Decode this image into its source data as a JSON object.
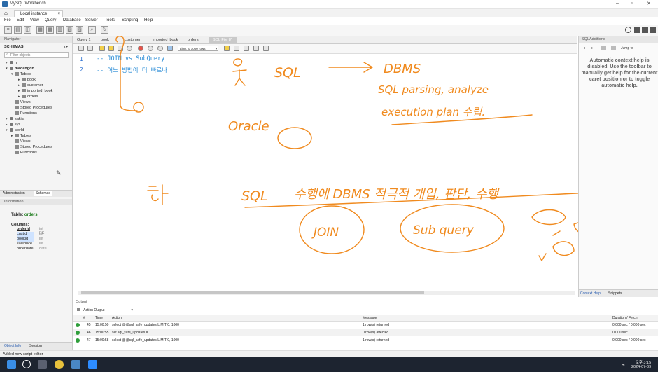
{
  "window": {
    "title": "MySQL Workbench",
    "instance_tab": "Local instance MySQL80"
  },
  "menu": [
    "File",
    "Edit",
    "View",
    "Query",
    "Database",
    "Server",
    "Tools",
    "Scripting",
    "Help"
  ],
  "navigator": {
    "header": "Navigator",
    "schemas_label": "SCHEMAS",
    "filter_placeholder": "Filter objects",
    "tree": {
      "hr": "hr",
      "madangdb": "madangdb",
      "tables": "Tables",
      "book": "book",
      "customer": "customer",
      "imported_book": "imported_book",
      "orders": "orders",
      "views": "Views",
      "procs": "Stored Procedures",
      "funcs": "Functions",
      "sakila": "sakila",
      "sys": "sys",
      "world": "world",
      "w_tables": "Tables",
      "w_views": "Views",
      "w_procs": "Stored Procedures",
      "w_funcs": "Functions"
    },
    "tabs": {
      "admin": "Administration",
      "schemas": "Schemas"
    }
  },
  "information": {
    "header": "Information",
    "table_label": "Table:",
    "table_name": "orders",
    "columns_label": "Columns:",
    "columns": [
      {
        "name": "orderid",
        "type": "int PK"
      },
      {
        "name": "custid",
        "type": "int"
      },
      {
        "name": "bookid",
        "type": "int"
      },
      {
        "name": "saleprice",
        "type": "int"
      },
      {
        "name": "orderdate",
        "type": "date"
      }
    ],
    "tabs": {
      "object": "Object Info",
      "session": "Session"
    }
  },
  "editor_tabs": [
    "Query 1",
    "book",
    "customer",
    "imported_book",
    "orders",
    "SQL File 8*"
  ],
  "limit_select": "Limit to 1000 rows",
  "code_lines": [
    {
      "no": "1",
      "text": "-- JOIN vs SubQuery"
    },
    {
      "no": "2",
      "text": "-- 어느 방법이 더 빠르나"
    }
  ],
  "annotations": {
    "sql": "SQL",
    "dbms": "DBMS",
    "parsing": "SQL parsing, analyze",
    "execution": "execution plan 수립.",
    "oracle": "Oracle",
    "sql2": "SQL",
    "korean_line": "수행에  DBMS  적극적 개입, 판단, 수행",
    "join": "JOIN",
    "subquery": "Sub query"
  },
  "sql_additions": {
    "header": "SQLAdditions",
    "jump_to": "Jump to",
    "help_text": "Automatic context help is disabled. Use the toolbar to manually get help for the current caret position or to toggle automatic help.",
    "tabs": {
      "context": "Context Help",
      "snippets": "Snippets"
    }
  },
  "output": {
    "header": "Output",
    "mode": "Action Output",
    "columns": [
      "#",
      "Time",
      "Action",
      "Message",
      "Duration / Fetch"
    ],
    "rows": [
      {
        "num": "45",
        "time": "15:00:50",
        "action": "select @@sql_safe_updates LIMIT 0, 1000",
        "message": "1 row(s) returned",
        "duration": "0.000 sec / 0.000 sec"
      },
      {
        "num": "46",
        "time": "15:00:55",
        "action": "set sql_safe_updates = 1",
        "message": "0 row(s) affected",
        "duration": "0.000 sec"
      },
      {
        "num": "47",
        "time": "15:00:58",
        "action": "select @@sql_safe_updates LIMIT 0, 1000",
        "message": "1 row(s) returned",
        "duration": "0.000 sec / 0.000 sec"
      }
    ],
    "status_color": "#2e9e3a"
  },
  "statusbar": {
    "text": "Added new script editor"
  },
  "taskbar": {
    "time": "오후 3:15",
    "date": "2024-07-09"
  }
}
